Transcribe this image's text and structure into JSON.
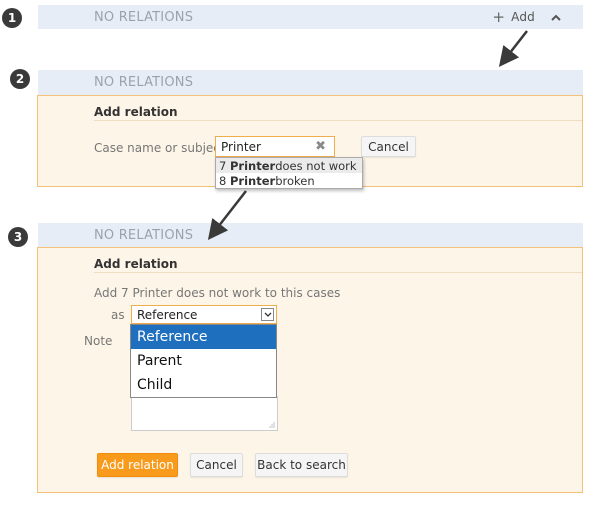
{
  "steps": [
    "1",
    "2",
    "3"
  ],
  "relations_bar": {
    "empty_label": "NO RELATIONS"
  },
  "add_control": {
    "plus_icon": "+",
    "label": "Add",
    "caret": "^"
  },
  "panel": {
    "title": "Add relation",
    "search_label": "Case name or subject",
    "search_value": "Printer",
    "clear_icon": "✖",
    "cancel_label": "Cancel"
  },
  "suggestions": [
    {
      "id": "7",
      "match": "Printer",
      "rest": " does not work"
    },
    {
      "id": "8",
      "match": "Printer",
      "rest": " broken"
    }
  ],
  "panel3": {
    "title": "Add relation",
    "description": "Add 7 Printer does not work to this cases",
    "as_label": "as",
    "select_value": "Reference",
    "note_label": "Note",
    "options": [
      "Reference",
      "Parent",
      "Child"
    ],
    "add_button": "Add relation",
    "cancel_button": "Cancel",
    "back_button": "Back to search"
  },
  "colors": {
    "bar_bg": "#e6edf6",
    "panel_bg": "#fdf5e8",
    "panel_border": "#f3c278",
    "primary": "#f89b1c",
    "selected_option": "#1f6fbf"
  }
}
